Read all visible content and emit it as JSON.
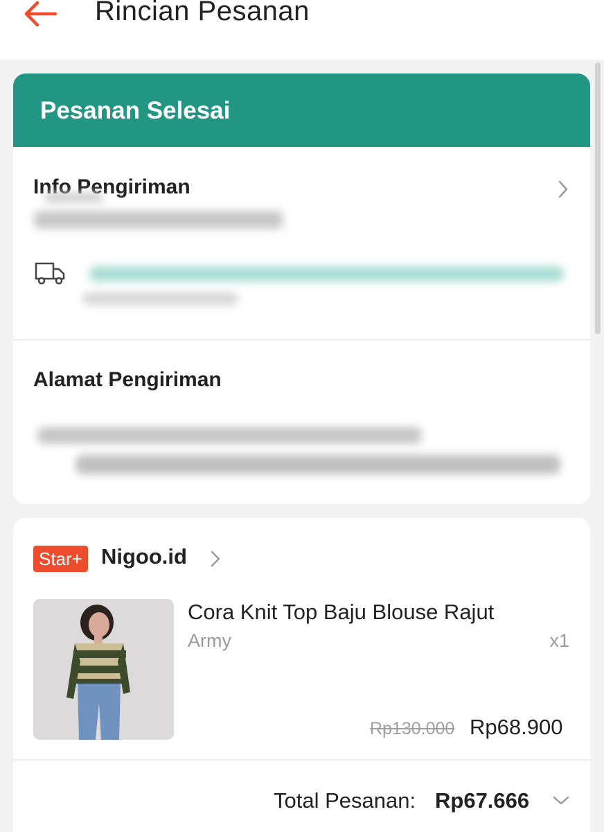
{
  "header": {
    "title": "Rincian Pesanan",
    "back_icon": "arrow-left-icon",
    "accent": "#ee4d2d"
  },
  "order": {
    "status": "Pesanan Selesai",
    "status_color": "#219682"
  },
  "shipping_info": {
    "title": "Info Pengiriman",
    "icon": "truck-icon"
  },
  "address": {
    "title": "Alamat Pengiriman"
  },
  "shop": {
    "badge": "Star+",
    "name": "Nigoo.id"
  },
  "product": {
    "name": "Cora Knit Top Baju Blouse Rajut",
    "variant": "Army",
    "quantity": "x1",
    "original_price": "Rp130.000",
    "price": "Rp68.900"
  },
  "total": {
    "label": "Total Pesanan:",
    "value": "Rp67.666"
  }
}
